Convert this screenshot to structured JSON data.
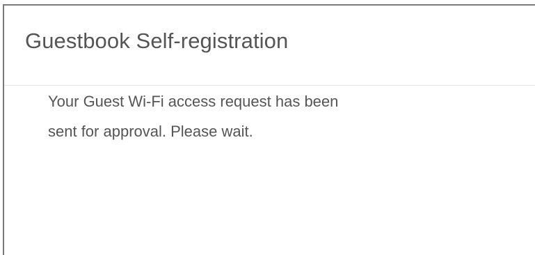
{
  "panel": {
    "title": "Guestbook Self-registration",
    "message_line_1": "Your Guest Wi-Fi access request has been",
    "message_line_2": "sent for approval. Please wait."
  }
}
